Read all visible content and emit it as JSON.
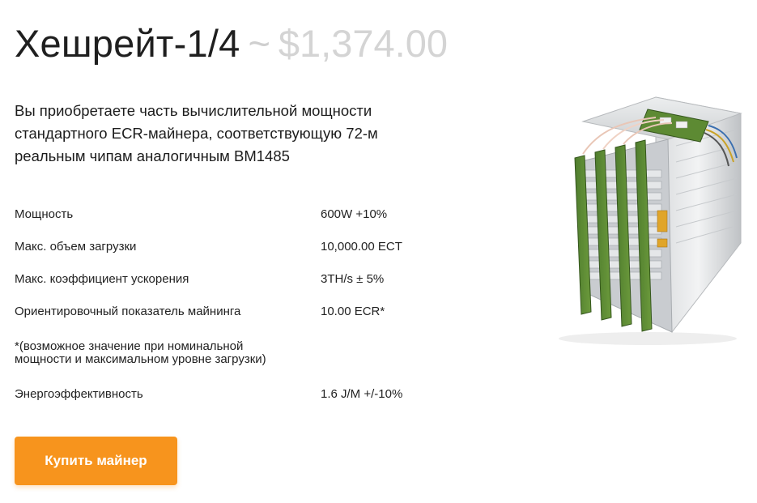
{
  "product": {
    "title": "Хешрейт-1/4",
    "separator": "~",
    "price": "$1,374.00",
    "description": "Вы приобретаете часть вычислительной мощности стандартного ECR-майнера, соответствующую 72-м реальным чипам аналогичным BM1485"
  },
  "specs": [
    {
      "label": "Мощность",
      "value": "600W +10%"
    },
    {
      "label": "Макс. объем загрузки",
      "value": "10,000.00 ECT"
    },
    {
      "label": "Макс. коэффициент ускорения",
      "value": "3TH/s ± 5%"
    },
    {
      "label": "Ориентировочный показатель майнинга",
      "value": "10.00 ECR*"
    }
  ],
  "note_line1": "*(возможное значение при номинальной",
  "note_line2": "мощности и максимальном уровне загрузки)",
  "efficiency": {
    "label": "Энергоэффективность",
    "value": "1.6 J/M +/-10%"
  },
  "buy_button_label": "Купить майнер",
  "colors": {
    "accent": "#f7941d",
    "price": "#d4d4d4",
    "text": "#1c1c1c"
  },
  "image_icon": "asic-miner-image"
}
